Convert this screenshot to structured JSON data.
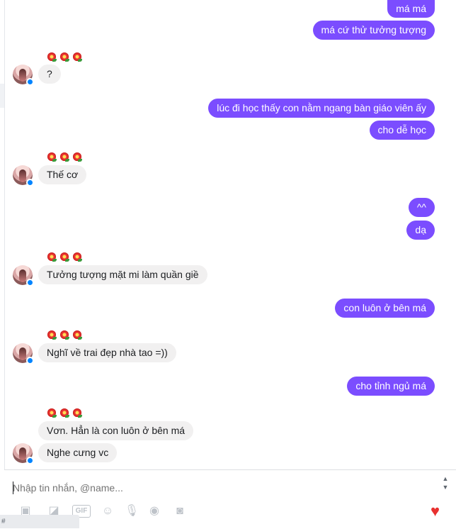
{
  "messages": {
    "m1": "má má",
    "m2": "má cứ thử tưởng tượng",
    "m3": "?",
    "m4": "lúc đi học thấy con nằm ngang bàn giáo viên ấy",
    "m5": "cho dễ học",
    "m6": "Thế cơ",
    "m7": "^^",
    "m8": "dạ",
    "m9": "Tưởng tượng mặt mi làm quần giề",
    "m10": "con luôn ở bên má",
    "m11": "Nghĩ về trai đẹp nhà tao =))",
    "m12": "cho tỉnh ngủ má",
    "m13": "Vơn. Hẳn là con luôn ở bên má",
    "m14": "Nghe cưng vc"
  },
  "composer": {
    "placeholder": "Nhập tin nhắn, @name...",
    "gif_label": "GIF"
  },
  "icons": {
    "outgoing_bubble_color": "#7b4dff",
    "incoming_bubble_color": "#f1f0f0",
    "reaction": "hibiscus-flower-icon",
    "send_like": "heart-icon"
  },
  "status_tab": "#"
}
